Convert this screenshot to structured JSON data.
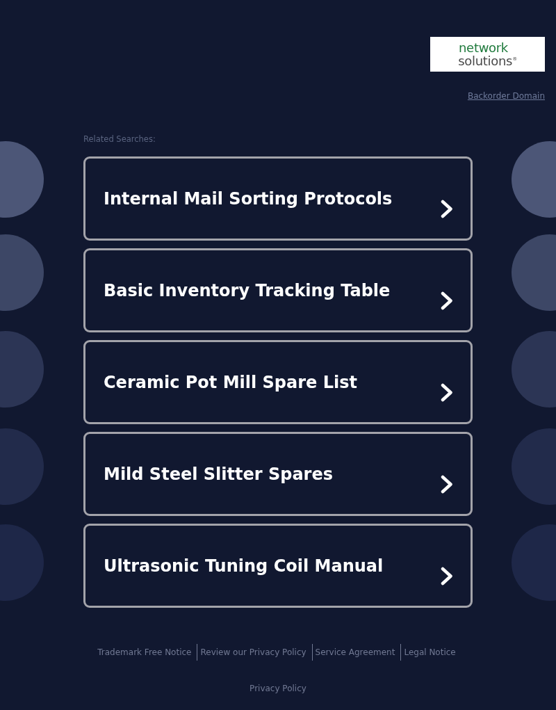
{
  "header": {
    "logo": {
      "lines": [
        "network",
        "solutions$^{®}$"
      ]
    },
    "link": "Backorder Domain"
  },
  "related": {
    "heading": "Related Searches:",
    "items": [
      "Internal Mail Sorting Protocols",
      "Basic Inventory Tracking Table",
      "Ceramic Pot Mill Spare List",
      "Mild Steel Slitter Spares",
      "Ultrasonic Tuning Coil Manual"
    ]
  },
  "footer": {
    "links": [
      "Trademark Free Notice",
      "Review our Privacy Policy",
      "Service Agreement",
      "Legal Notice"
    ],
    "privacy": "Privacy Policy"
  }
}
